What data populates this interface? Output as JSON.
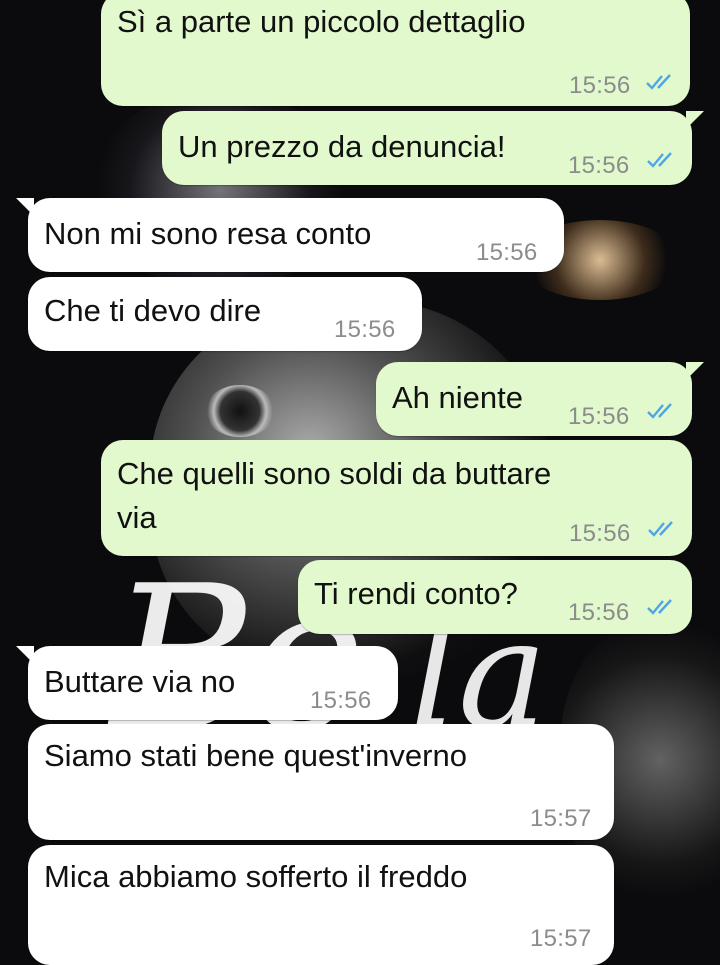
{
  "messages": [
    {
      "text": "Sì a parte un piccolo dettaglio",
      "time": "15:56",
      "direction": "out",
      "status": "read",
      "ticks_color": "#4fa6e6"
    },
    {
      "text": "Un prezzo da denuncia!",
      "time": "15:56",
      "direction": "out",
      "status": "read",
      "ticks_color": "#4fa6e6"
    },
    {
      "text": "Non mi sono resa conto",
      "time": "15:56",
      "direction": "in"
    },
    {
      "text": "Che ti devo dire",
      "time": "15:56",
      "direction": "in"
    },
    {
      "text": "Ah niente",
      "time": "15:56",
      "direction": "out",
      "status": "read",
      "ticks_color": "#4fa6e6"
    },
    {
      "text_line1": "Che quelli sono soldi da buttare",
      "text_line2": "via",
      "time": "15:56",
      "direction": "out",
      "status": "read",
      "ticks_color": "#4fa6e6"
    },
    {
      "text": "Ti rendi conto?",
      "time": "15:56",
      "direction": "out",
      "status": "read",
      "ticks_color": "#4fa6e6"
    },
    {
      "text": "Buttare via no",
      "time": "15:56",
      "direction": "in"
    },
    {
      "text": "Siamo stati bene quest'inverno",
      "time": "15:57",
      "direction": "in"
    },
    {
      "text": "Mica abbiamo sofferto il freddo",
      "time": "15:57",
      "direction": "in"
    }
  ],
  "colors": {
    "outgoing_bubble": "#e1f9cd",
    "incoming_bubble": "#ffffff",
    "read_ticks": "#4fa6e6",
    "timestamp": "#8c8c8c"
  }
}
